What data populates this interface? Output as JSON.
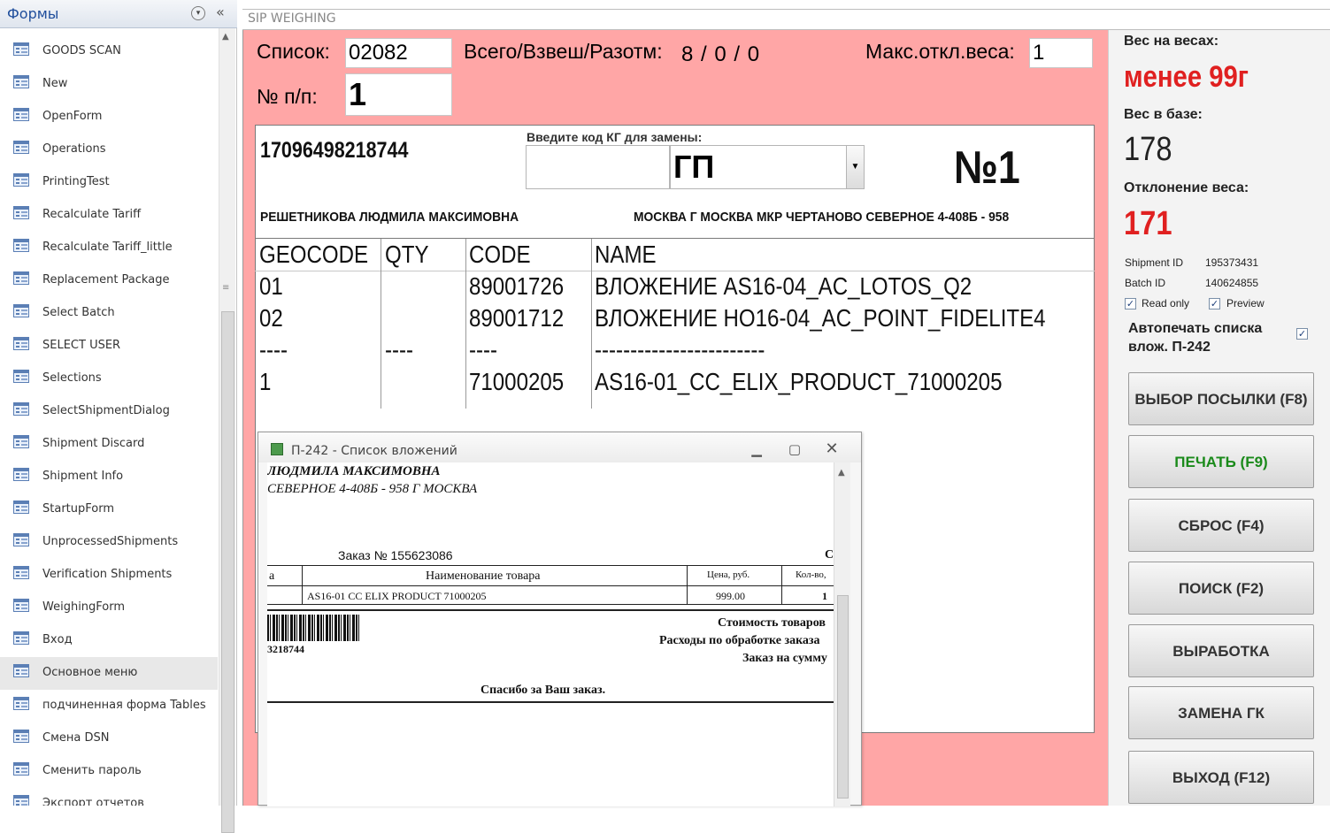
{
  "nav": {
    "title": "Формы",
    "filter_icon": "chevron-down-circle-icon",
    "collapse_glyph": "«",
    "items": [
      {
        "label": "GOODS SCAN"
      },
      {
        "label": "New"
      },
      {
        "label": "OpenForm"
      },
      {
        "label": "Operations"
      },
      {
        "label": "PrintingTest"
      },
      {
        "label": "Recalculate Tariff"
      },
      {
        "label": "Recalculate Tariff_little"
      },
      {
        "label": "Replacement Package"
      },
      {
        "label": "Select Batch"
      },
      {
        "label": "SELECT USER"
      },
      {
        "label": "Selections"
      },
      {
        "label": "SelectShipmentDialog"
      },
      {
        "label": "Shipment Discard"
      },
      {
        "label": "Shipment Info"
      },
      {
        "label": "StartupForm"
      },
      {
        "label": "UnprocessedShipments"
      },
      {
        "label": "Verification Shipments"
      },
      {
        "label": "WeighingForm"
      },
      {
        "label": "Вход"
      },
      {
        "label": "Основное меню",
        "selected": true
      },
      {
        "label": "подчиненная форма Tables"
      },
      {
        "label": "Смена DSN"
      },
      {
        "label": "Сменить пароль"
      },
      {
        "label": "Экспорт отчетов"
      }
    ]
  },
  "form": {
    "tab_label": "SIP WEIGHING",
    "background_color": "#ffa6a6",
    "list_label": "Список:",
    "list_value": "02082",
    "total_label": "Всего/Взвеш/Разотм:",
    "total_value": "8 / 0 / 0",
    "max_dev_label": "Макс.откл.веса:",
    "max_dev_value": "1",
    "seq_label": "№ п/п:",
    "seq_value": "1"
  },
  "shipment": {
    "barcode": "17096498218744",
    "replace_label": "Введите код КГ для замены:",
    "replace_code_value": "",
    "type_value": "ГП",
    "number": "№1",
    "recipient": "РЕШЕТНИКОВА ЛЮДМИЛА МАКСИМОВНА",
    "address": "МОСКВА  Г МОСКВА МКР ЧЕРТАНОВО СЕВЕРНОЕ 4-408Б - 958",
    "columns": [
      "GEOCODE",
      "QTY",
      "CODE",
      "NAME"
    ],
    "rows": [
      {
        "geocode": "01",
        "qty": "",
        "code": "89001726",
        "name": "ВЛОЖЕНИЕ AS16-04_AC_LOTOS_Q2"
      },
      {
        "geocode": "02",
        "qty": "",
        "code": "89001712",
        "name": "ВЛОЖЕНИЕ НО16-04_AC_POINT_FIDELITE4"
      },
      {
        "geocode": "----",
        "qty": "----",
        "code": "----",
        "name": "------------------------"
      },
      {
        "geocode": "1",
        "qty": "",
        "code": "71000205",
        "name": "AS16-01_CC_ELIX_PRODUCT_71000205"
      }
    ]
  },
  "report": {
    "title": "П-242 - Список вложений",
    "line1": "ЛЮДМИЛА МАКСИМОВНА",
    "line2": "СЕВЕРНОЕ 4-408Б - 958 Г МОСКВА",
    "order": "Заказ № 155623086",
    "order_right": "С",
    "col_a": "а",
    "col_name": "Наименование товара",
    "col_price": "Цена, руб.",
    "col_qty": "Кол-во,",
    "item_name": "AS16-01  CC  ELIX  PRODUCT  71000205",
    "item_price": "999.00",
    "item_qty": "1",
    "barcode_digits": "3218744",
    "cost_goods": "Стоимость товаров",
    "cost_processing": "Расходы по обработке заказа",
    "order_sum": "Заказ на сумму",
    "thanks": "Спасибо за Ваш заказ."
  },
  "panel": {
    "weight_on_scale_label": "Вес на весах:",
    "weight_on_scale_value": "менее 99г",
    "weight_in_db_label": "Вес в базе:",
    "weight_in_db_value": "178",
    "deviation_label": "Отклонение веса:",
    "deviation_value": "171",
    "shipment_id_label": "Shipment ID",
    "shipment_id_value": "195373431",
    "batch_id_label": "Batch ID",
    "batch_id_value": "140624855",
    "read_only_label": "Read only",
    "read_only_checked": true,
    "preview_label": "Preview",
    "preview_checked": true,
    "autoprint_label": "Автопечать списка влож. П-242",
    "autoprint_checked": true,
    "accent_red": "#e02020",
    "print_green": "#1a8a1a",
    "buttons": {
      "select": "ВЫБОР ПОСЫЛКИ (F8)",
      "print": "ПЕЧАТЬ (F9)",
      "reset": "СБРОС (F4)",
      "search": "ПОИСК (F2)",
      "output": "ВЫРАБОТКА",
      "replace": "ЗАМЕНА ГК",
      "exit": "ВЫХОД (F12)"
    }
  }
}
